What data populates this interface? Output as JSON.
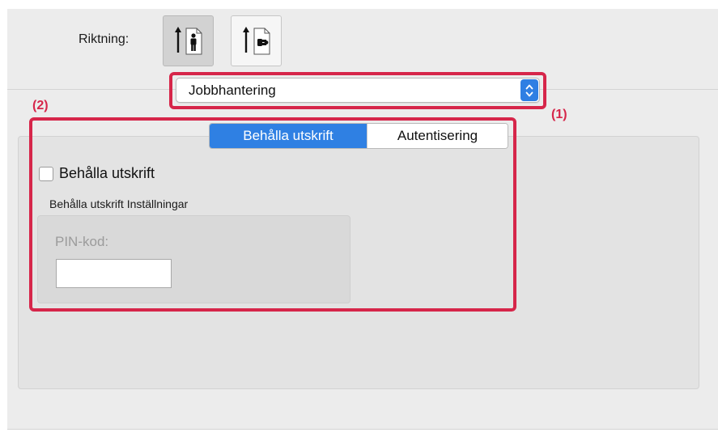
{
  "orientation": {
    "label": "Riktning:",
    "options": [
      {
        "icon": "portrait-orientation-icon",
        "selected": true
      },
      {
        "icon": "landscape-orientation-icon",
        "selected": false
      }
    ]
  },
  "panel_menu": {
    "selected": "Jobbhantering",
    "icon": "updown-arrows-icon"
  },
  "callouts": {
    "one": "(1)",
    "two": "(2)"
  },
  "tabs": [
    {
      "label": "Behålla utskrift",
      "active": true
    },
    {
      "label": "Autentisering",
      "active": false
    }
  ],
  "retention": {
    "checkbox_label": "Behålla utskrift",
    "checked": false,
    "settings_title": "Behålla utskrift Inställningar",
    "pin_label": "PIN-kod:",
    "pin_value": ""
  },
  "colors": {
    "accent": "#2f80e3",
    "callout": "#d6264a",
    "background": "#ececec"
  }
}
